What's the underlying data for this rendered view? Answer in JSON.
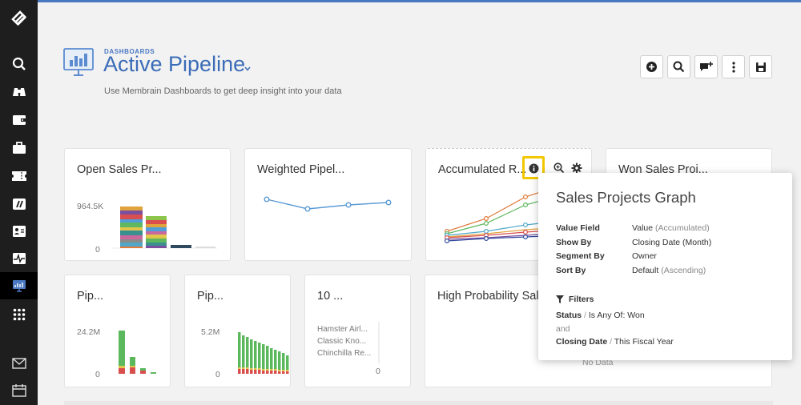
{
  "sidebar": {
    "items": [
      {
        "icon": "logo-icon"
      },
      {
        "icon": "search-icon"
      },
      {
        "icon": "binoculars-icon"
      },
      {
        "icon": "wallet-icon"
      },
      {
        "icon": "briefcase-icon"
      },
      {
        "icon": "ticket-icon"
      },
      {
        "icon": "slash-tag-icon"
      },
      {
        "icon": "contact-card-icon"
      },
      {
        "icon": "activity-icon"
      },
      {
        "icon": "dashboard-icon"
      },
      {
        "icon": "apps-grid-icon"
      },
      {
        "icon": "mail-icon"
      },
      {
        "icon": "calendar-icon"
      }
    ],
    "active": "dashboard-icon",
    "accent": "#4a78c2"
  },
  "header": {
    "breadcrumb": "DASHBOARDS",
    "title": "Active Pipeline",
    "subtitle": "Use Membrain Dashboards to get deep insight into your data"
  },
  "toolbar": {
    "buttons": [
      "add-icon",
      "search-icon",
      "add-comment-icon",
      "more-vertical-icon",
      "save-icon"
    ]
  },
  "cards": [
    {
      "title": "Open Sales Pr...",
      "y_top": "964.5K",
      "y_zero": "0"
    },
    {
      "title": "Weighted Pipel..."
    },
    {
      "title": "Accumulated R..."
    },
    {
      "title": "Won Sales Proj..."
    },
    {
      "title": "Pip...",
      "y_top": "24.2M",
      "y_zero": "0"
    },
    {
      "title": "Pip...",
      "y_top": "5.2M",
      "y_zero": "0"
    },
    {
      "title": "10 ...",
      "rows": [
        "Hamster Airl...",
        "Classic Kno...",
        "Chinchilla Re..."
      ],
      "x_zero": "0"
    },
    {
      "title": "High Probability Sales",
      "empty": "No Data"
    }
  ],
  "popup": {
    "title": "Sales Projects Graph",
    "rows": [
      {
        "key": "Value Field",
        "value": "Value",
        "note": "(Accumulated)"
      },
      {
        "key": "Show By",
        "value": "Closing Date (Month)",
        "note": ""
      },
      {
        "key": "Segment By",
        "value": "Owner",
        "note": ""
      },
      {
        "key": "Sort By",
        "value": "Default",
        "note": "(Ascending)"
      }
    ],
    "filters_label": "Filters",
    "filters": [
      {
        "field": "Status",
        "sep": "/",
        "condition": "Is Any Of: Won"
      },
      {
        "join": "and"
      },
      {
        "field": "Closing Date",
        "sep": "/",
        "condition": "This Fiscal Year"
      }
    ]
  },
  "colors": {
    "title_blue": "#3b6cb7",
    "highlight": "#f2c800",
    "green_bar": "#5cb85c",
    "red_bar": "#d9534f",
    "line_blue": "#5b9bd5"
  }
}
